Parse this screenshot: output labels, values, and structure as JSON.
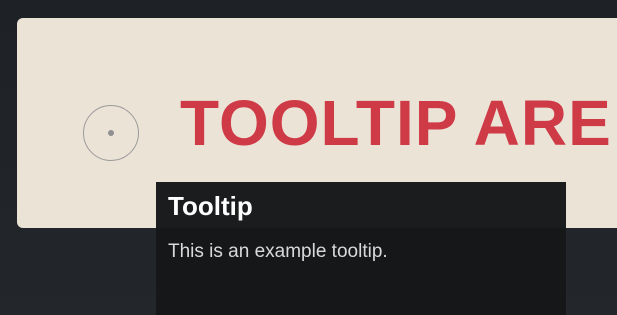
{
  "card": {
    "heading": "TOOLTIP ARE"
  },
  "tooltip": {
    "title": "Tooltip",
    "body": "This is an example tooltip."
  },
  "colors": {
    "background": "#1f2226",
    "card": "#ebe3d6",
    "heading": "#cf3a47",
    "tooltip_bg": "#161718"
  },
  "icons": {
    "target": "circle-dot-icon"
  }
}
